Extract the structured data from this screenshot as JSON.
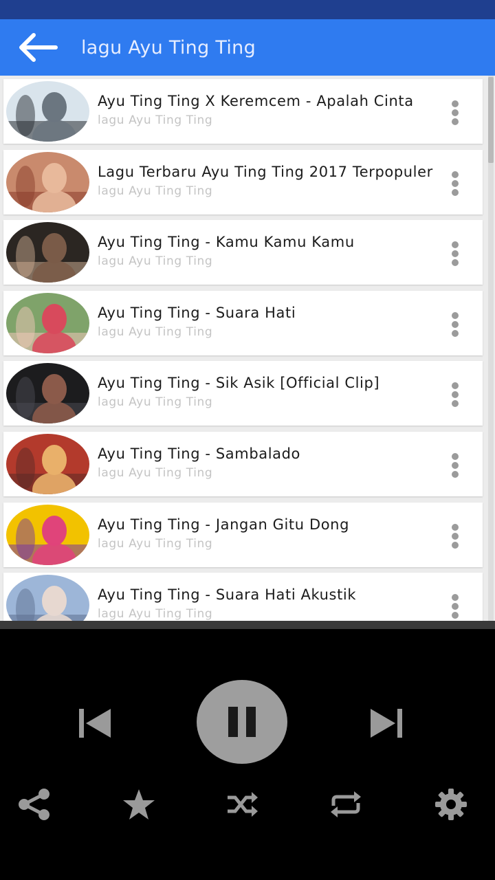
{
  "app_bar": {
    "title": "lagu Ayu Ting Ting"
  },
  "list": {
    "items": [
      {
        "title": "Ayu Ting Ting X Keremcem - Apalah Cinta",
        "subtitle": "lagu Ayu Ting Ting",
        "thumb_colors": [
          "#d9e4ec",
          "#6b7680",
          "#2a2e33"
        ]
      },
      {
        "title": "Lagu Terbaru Ayu Ting Ting 2017 Terpopuler",
        "subtitle": "lagu Ayu Ting Ting",
        "thumb_colors": [
          "#c98a6d",
          "#e8b99b",
          "#8a3d2c"
        ]
      },
      {
        "title": "Ayu Ting Ting - Kamu Kamu Kamu",
        "subtitle": "lagu Ayu Ting Ting",
        "thumb_colors": [
          "#2b2622",
          "#7a5b48",
          "#c7a88e"
        ]
      },
      {
        "title": "Ayu Ting Ting - Suara Hati",
        "subtitle": "lagu Ayu Ting Ting",
        "thumb_colors": [
          "#7fa36a",
          "#d84a5c",
          "#f0c7b8"
        ]
      },
      {
        "title": "Ayu Ting Ting - Sik Asik [Official  Clip]",
        "subtitle": "lagu Ayu Ting Ting",
        "thumb_colors": [
          "#1c1c1e",
          "#8b5a4a",
          "#4a4a52"
        ]
      },
      {
        "title": "Ayu Ting Ting - Sambalado",
        "subtitle": "lagu Ayu Ting Ting",
        "thumb_colors": [
          "#b33a2c",
          "#e9b06a",
          "#5b2a26"
        ]
      },
      {
        "title": "Ayu Ting Ting - Jangan Gitu Dong",
        "subtitle": "lagu Ayu Ting Ting",
        "thumb_colors": [
          "#f2c200",
          "#e0447a",
          "#7a3aa0"
        ]
      },
      {
        "title": "Ayu Ting Ting - Suara Hati Akustik",
        "subtitle": "lagu Ayu Ting Ting",
        "thumb_colors": [
          "#9db6d8",
          "#e7d8d0",
          "#5d6f90"
        ]
      }
    ]
  },
  "player": {
    "controls": [
      "previous-icon",
      "pause-icon",
      "next-icon"
    ],
    "actions": [
      "share-icon",
      "star-icon",
      "shuffle-icon",
      "repeat-icon",
      "gear-icon"
    ]
  },
  "colors": {
    "app_bar": "#2f7bf0",
    "status_bar": "#1f3f8f",
    "icon": "#9a9a9a"
  }
}
